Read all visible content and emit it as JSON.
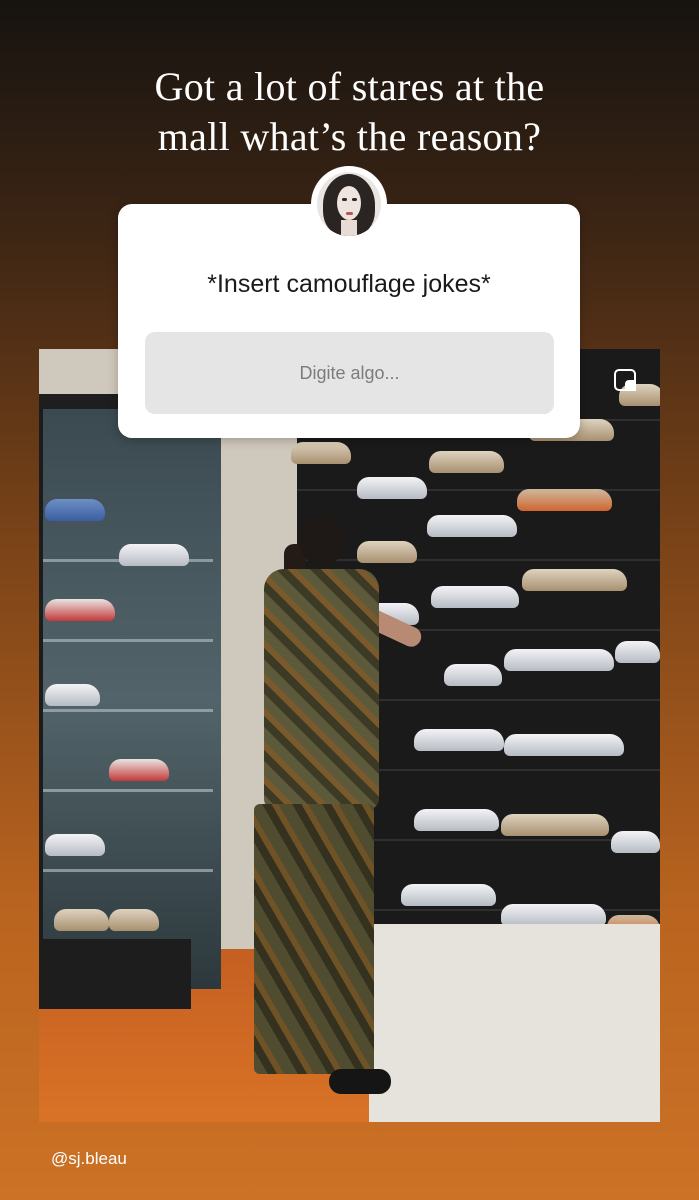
{
  "caption": {
    "line1": "Got a lot of stares at the",
    "line2": "mall what’s the reason?"
  },
  "question_sticker": {
    "question": "*Insert camouflage jokes*",
    "answer_placeholder": "Digite algo..."
  },
  "photo": {
    "description_icon": "sticker-icon"
  },
  "footer": {
    "handle": "@sj.bleau"
  }
}
